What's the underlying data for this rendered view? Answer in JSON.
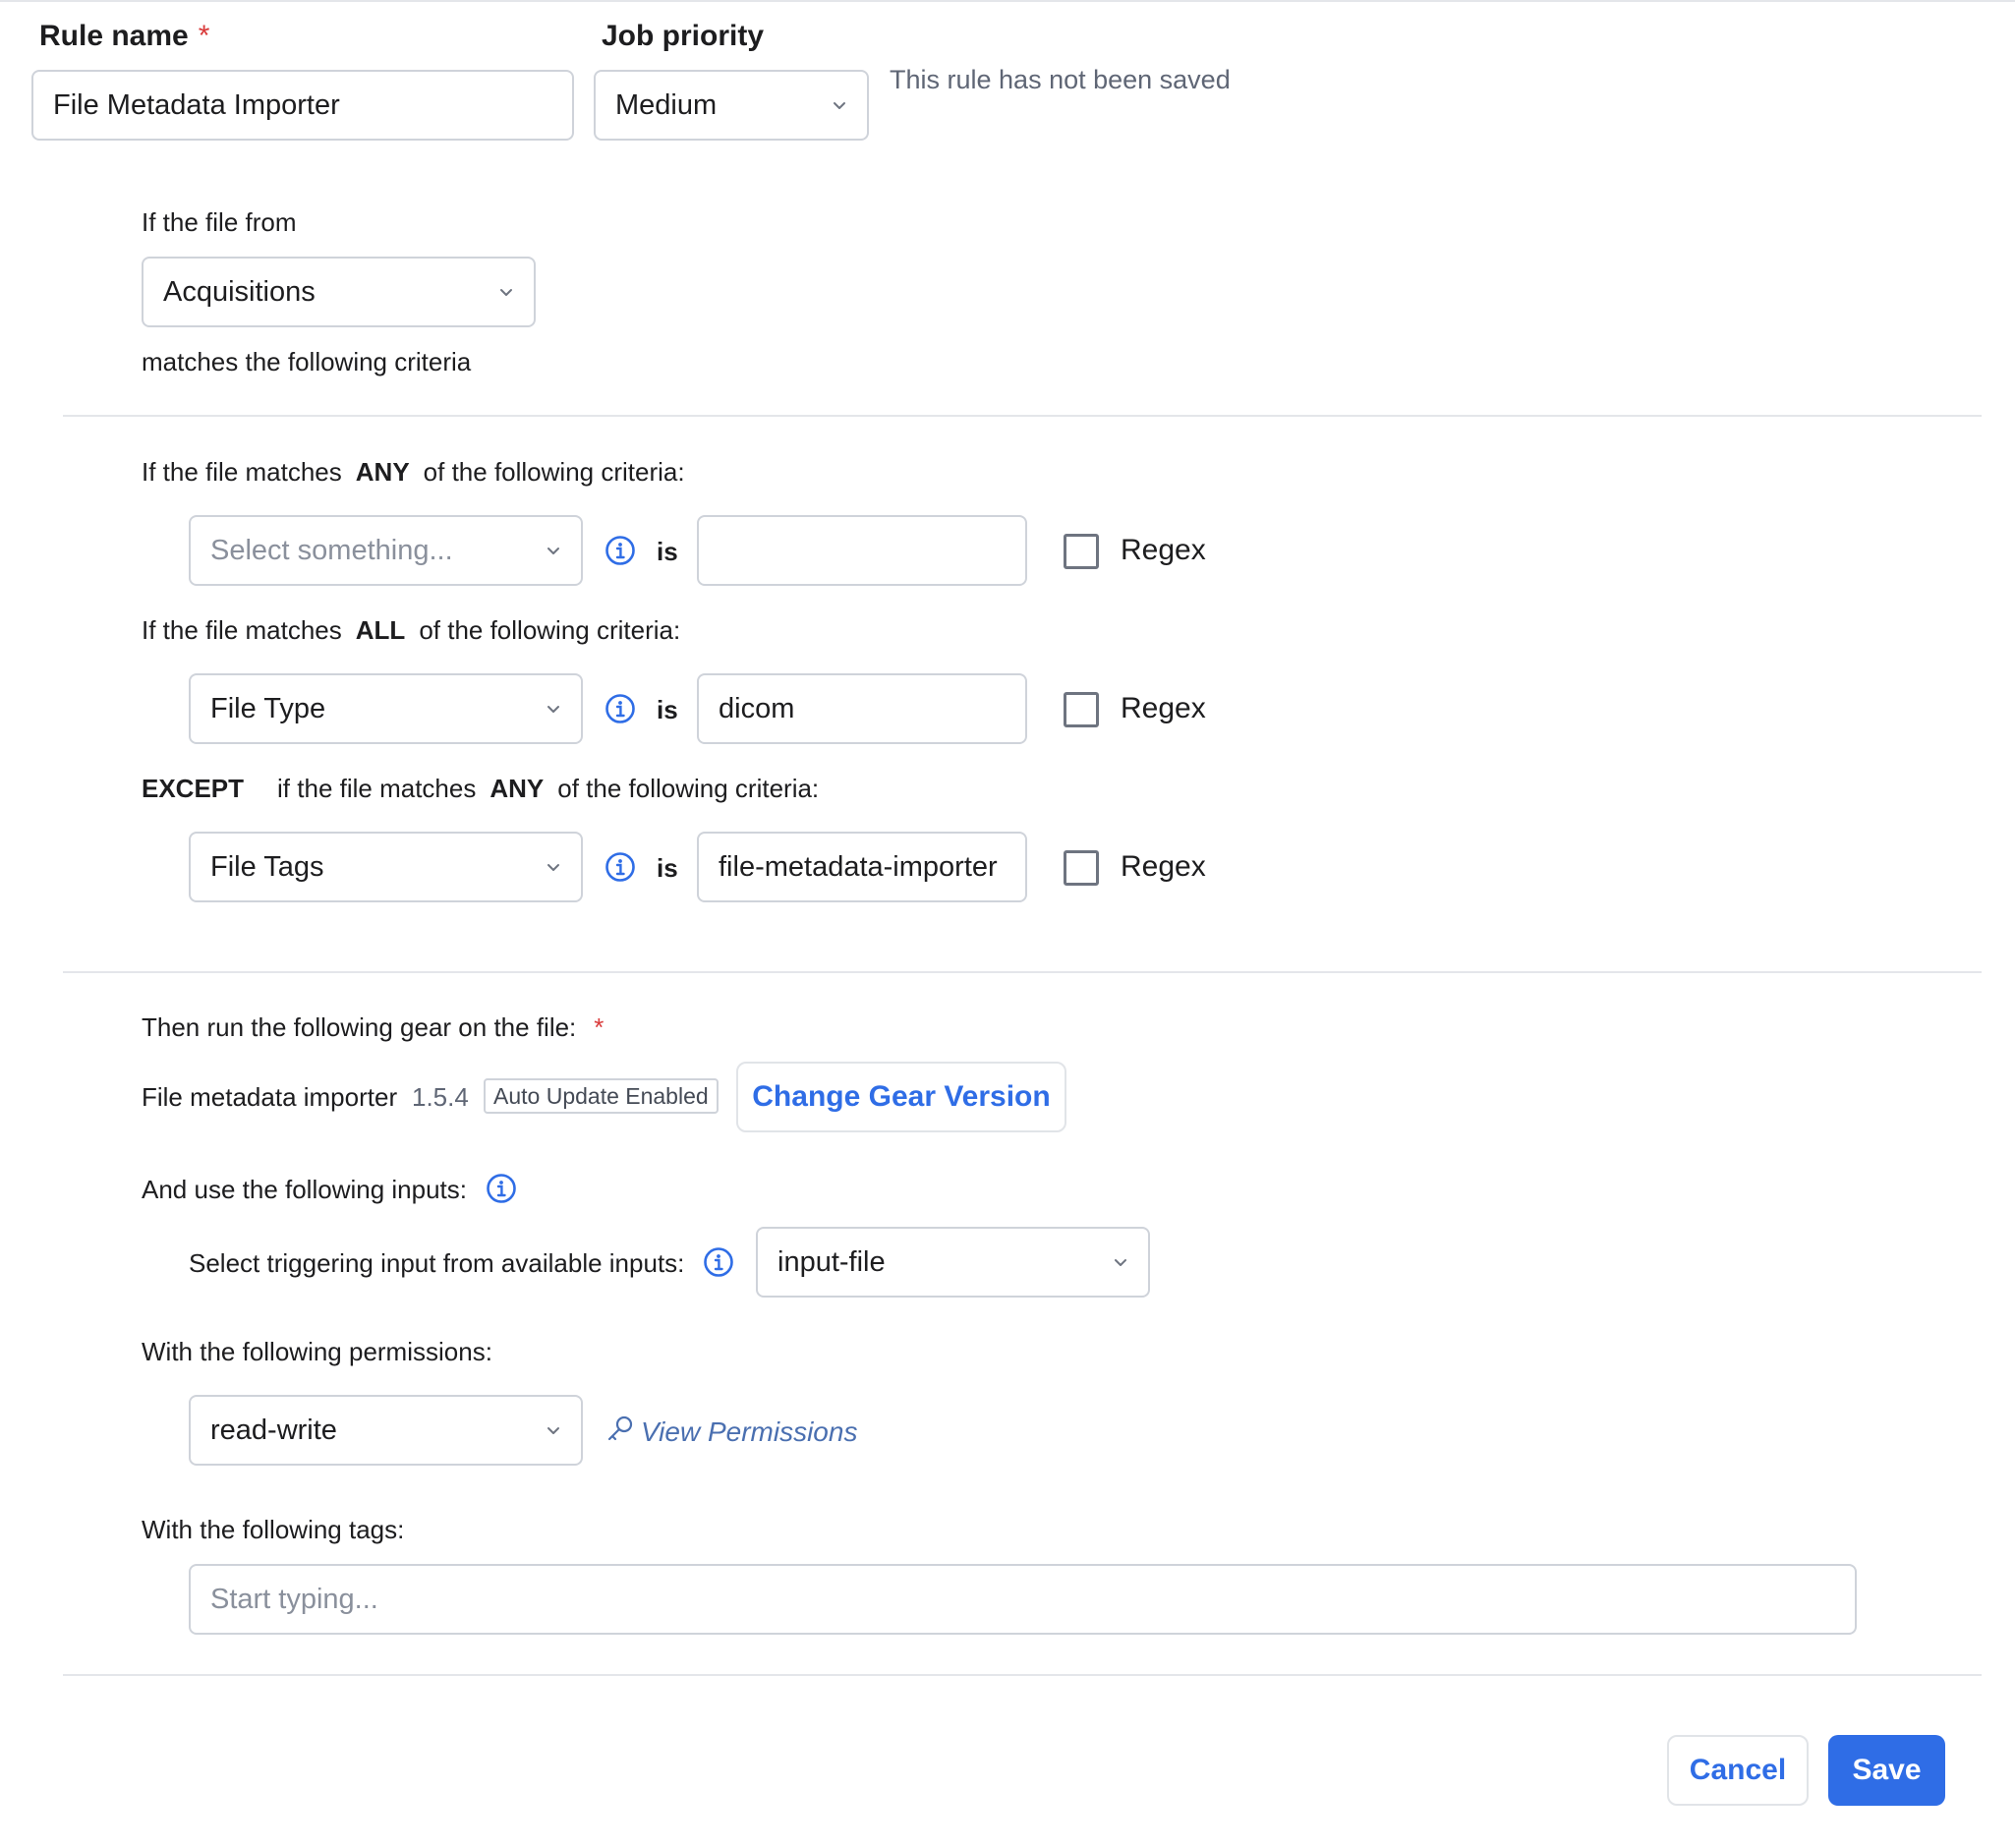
{
  "header": {
    "rule_name_label": "Rule name",
    "required_mark": "*",
    "rule_name_value": "File Metadata Importer",
    "job_priority_label": "Job priority",
    "job_priority_value": "Medium",
    "unsaved_notice": "This rule has not been saved"
  },
  "source": {
    "intro": "If the file from",
    "container_value": "Acquisitions",
    "outro": "matches the following criteria"
  },
  "criteria": {
    "any": {
      "prefix": "If the file matches",
      "keyword": "ANY",
      "suffix": "of the following criteria:",
      "field_placeholder": "Select something...",
      "operator": "is",
      "value": "",
      "regex_label": "Regex"
    },
    "all": {
      "prefix": "If the file matches",
      "keyword": "ALL",
      "suffix": "of the following criteria:",
      "field_value": "File Type",
      "operator": "is",
      "value": "dicom",
      "regex_label": "Regex"
    },
    "except": {
      "keyword_except": "EXCEPT",
      "prefix": "if the file matches",
      "keyword": "ANY",
      "suffix": "of the following criteria:",
      "field_value": "File Tags",
      "operator": "is",
      "value": "file-metadata-importer",
      "regex_label": "Regex"
    }
  },
  "gear": {
    "heading": "Then run the following gear on the file:",
    "required_mark": "*",
    "name": "File metadata importer",
    "version": "1.5.4",
    "auto_update_badge": "Auto Update Enabled",
    "change_version_label": "Change Gear Version",
    "inputs_heading": "And use the following inputs:",
    "trigger_label": "Select triggering input from available inputs:",
    "trigger_value": "input-file",
    "permissions_heading": "With the following permissions:",
    "permissions_value": "read-write",
    "view_permissions_label": "View Permissions",
    "tags_heading": "With the following tags:",
    "tags_placeholder": "Start typing..."
  },
  "footer": {
    "cancel_label": "Cancel",
    "save_label": "Save"
  },
  "colors": {
    "accent": "#2f6de6",
    "required": "#d93a3a",
    "border": "#cfd3da",
    "placeholder": "#8a909c"
  },
  "icons": {
    "dropdown": "chevron-down-icon",
    "info": "info-icon",
    "permissions_link": "key-icon"
  }
}
